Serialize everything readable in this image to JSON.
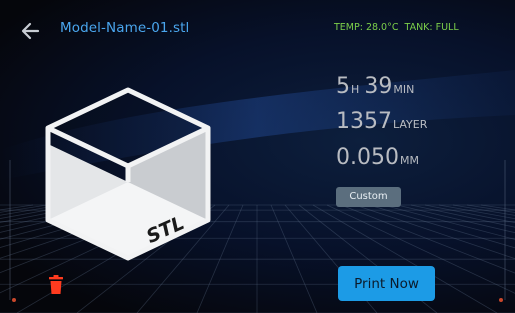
{
  "header": {
    "file_name": "Model-Name-01.stl",
    "temp_label": "TEMP: 28.0°C",
    "tank_label": "TANK: FULL"
  },
  "preview": {
    "label": "STL"
  },
  "stats": {
    "time_hours": "5",
    "time_hours_unit": "H",
    "time_minutes": "39",
    "time_minutes_unit": "MIN",
    "layers": "1357",
    "layers_unit": "LAYER",
    "layer_height": "0.050",
    "layer_height_unit": "MM"
  },
  "profile": {
    "label": "Custom"
  },
  "actions": {
    "print_label": "Print Now"
  },
  "colors": {
    "accent": "#1c9be6",
    "file_name": "#4aa6ee",
    "status": "#7ccf4a",
    "delete": "#ff3b1f"
  },
  "icons": {
    "back": "arrow-left-icon",
    "delete": "trash-icon"
  }
}
